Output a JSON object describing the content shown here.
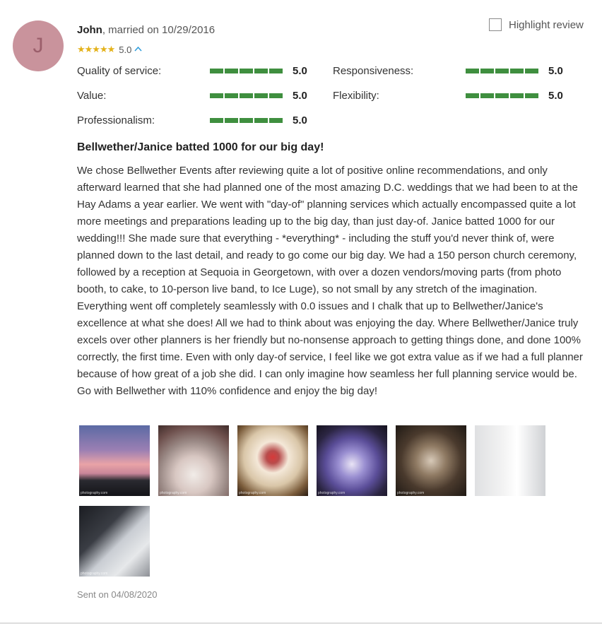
{
  "review": {
    "avatar_initial": "J",
    "author_name": "John",
    "author_meta": ", married on 10/29/2016",
    "stars": "★★★★★",
    "overall_rating": "5.0",
    "highlight_label": "Highlight review",
    "ratings": [
      {
        "label": "Quality of service:",
        "value": "5.0"
      },
      {
        "label": "Responsiveness:",
        "value": "5.0"
      },
      {
        "label": "Value:",
        "value": "5.0"
      },
      {
        "label": "Flexibility:",
        "value": "5.0"
      },
      {
        "label": "Professionalism:",
        "value": "5.0"
      }
    ],
    "title": "Bellwether/Janice batted 1000 for our big day!",
    "body": "We chose Bellwether Events after reviewing quite a lot of positive online recommendations, and only afterward learned that she had planned one of the most amazing D.C. weddings that we had been to at the Hay Adams a year earlier. We went with \"day-of\" planning services which actually encompassed quite a lot more meetings and preparations leading up to the big day, than just day-of. Janice batted 1000 for our wedding!!! She made sure that everything - *everything* - including the stuff you'd never think of, were planned down to the last detail, and ready to go come our big day. We had a 150 person church ceremony, followed by a reception at Sequoia in Georgetown, with over a dozen vendors/moving parts (from photo booth, to cake, to 10-person live band, to Ice Luge), so not small by any stretch of the imagination. Everything went off completely seamlessly with 0.0 issues and I chalk that up to Bellwether/Janice's excellence at what she does! All we had to think about was enjoying the day. Where Bellwether/Janice truly excels over other planners is her friendly but no-nonsense approach to getting things done, and done 100% correctly, the first time. Even with only day-of service, I feel like we got extra value as if we had a full planner because of how great of a job she did. I can only imagine how seamless her full planning service would be. Go with Bellwether with 110% confidence and enjoy the big day!",
    "photos": [
      {
        "subject": "sunset-sky",
        "credit": "photography.com"
      },
      {
        "subject": "reception-hall",
        "credit": "photography.com"
      },
      {
        "subject": "table-centerpiece",
        "credit": "photography.com"
      },
      {
        "subject": "ice-luge",
        "credit": "photography.com"
      },
      {
        "subject": "church-ceremony",
        "credit": "photography.com"
      },
      {
        "subject": "wedding-cake",
        "credit": ""
      },
      {
        "subject": "ice-luge-drink",
        "credit": "photography.com"
      }
    ],
    "sent": "Sent on 04/08/2020"
  },
  "colors": {
    "rating_bar": "#3f8f3f",
    "stars": "#e4b21b",
    "avatar": "#c9939c",
    "chevron": "#2d9cdb"
  }
}
